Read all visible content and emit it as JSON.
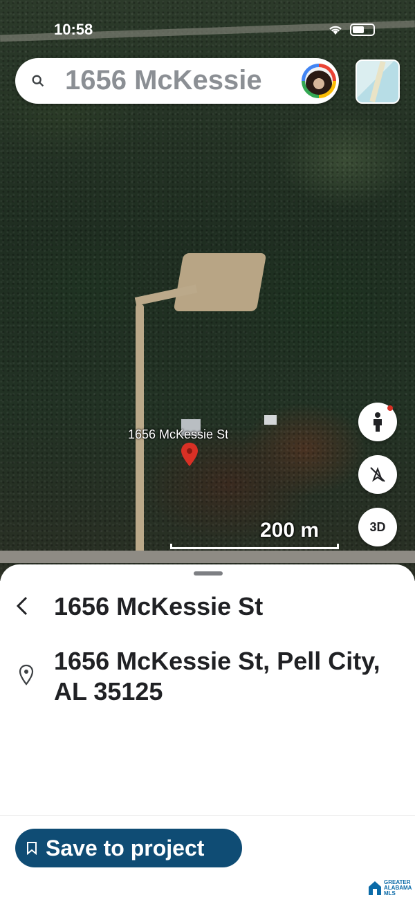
{
  "status_bar": {
    "time": "10:58"
  },
  "search": {
    "query": "1656 McKessie"
  },
  "map": {
    "place_label": "1656 McKessie St",
    "scale_label": "200 m",
    "controls": {
      "view_3d_label": "3D"
    }
  },
  "sheet": {
    "title": "1656 McKessie St",
    "address": "1656 McKessie St, Pell City, AL 35125",
    "save_label": "Save to project"
  },
  "logo": {
    "line1": "GREATER",
    "line2": "ALABAMA",
    "line3": "MLS"
  },
  "colors": {
    "save_button": "#0f4c74",
    "pin": "#d93025",
    "logo": "#0b6ba8"
  }
}
